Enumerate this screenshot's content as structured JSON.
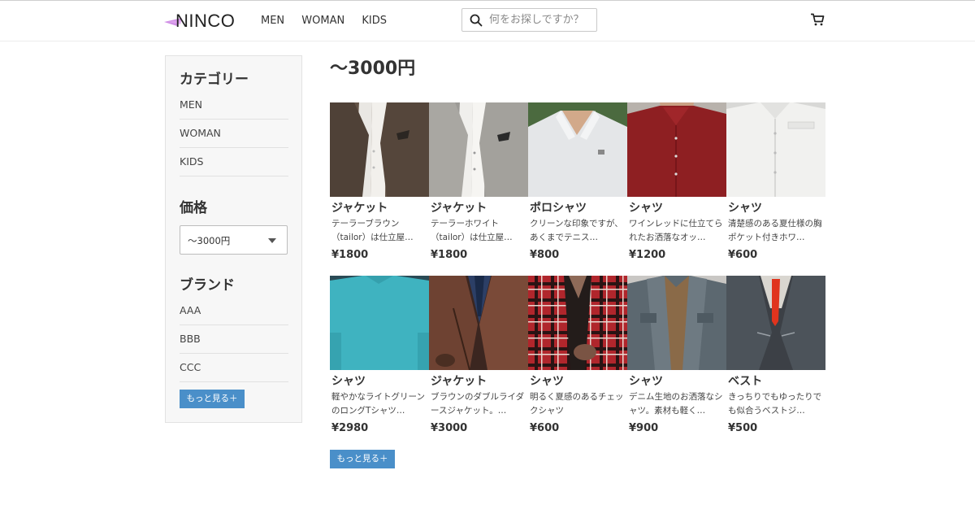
{
  "header": {
    "logo_text": "NINCO",
    "nav": [
      "MEN",
      "WOMAN",
      "KIDS"
    ],
    "search_placeholder": "何をお探しですか？",
    "icons": {
      "search": "search-icon",
      "cart": "cart-icon"
    }
  },
  "sidebar": {
    "category_heading": "カテゴリー",
    "categories": [
      "MEN",
      "WOMAN",
      "KIDS"
    ],
    "price_heading": "価格",
    "price_selected": "〜3000円",
    "brand_heading": "ブランド",
    "brands": [
      "AAA",
      "BBB",
      "CCC"
    ],
    "more_label": "もっと見る＋"
  },
  "main": {
    "title": "〜3000円",
    "more_label": "もっと見る＋",
    "products": [
      {
        "name": "ジャケット",
        "desc": "テーラーブラウン（tailor）は仕立屋…",
        "price": "¥1800"
      },
      {
        "name": "ジャケット",
        "desc": "テーラーホワイト（tailor）は仕立屋…",
        "price": "¥1800"
      },
      {
        "name": "ポロシャツ",
        "desc": "クリーンな印象ですが、あくまでテニス…",
        "price": "¥800"
      },
      {
        "name": "シャツ",
        "desc": "ワインレッドに仕立てられたお洒落なオッ…",
        "price": "¥1200"
      },
      {
        "name": "シャツ",
        "desc": "清楚感のある夏仕様の胸ポケット付きホワ…",
        "price": "¥600"
      },
      {
        "name": "シャツ",
        "desc": "軽やかなライトグリーンのロングTシャツ…",
        "price": "¥2980"
      },
      {
        "name": "ジャケット",
        "desc": "ブラウンのダブルライダースジャケット。…",
        "price": "¥3000"
      },
      {
        "name": "シャツ",
        "desc": "明るく夏感のあるチェックシャツ",
        "price": "¥600"
      },
      {
        "name": "シャツ",
        "desc": "デニム生地のお洒落なシャツ。素材も軽く…",
        "price": "¥900"
      },
      {
        "name": "ベスト",
        "desc": "きっちりでもゆったりでも似合うベストジ…",
        "price": "¥500"
      }
    ]
  },
  "colors": {
    "accent": "#4a8fc9",
    "logo_mark": "#c77ae0"
  }
}
